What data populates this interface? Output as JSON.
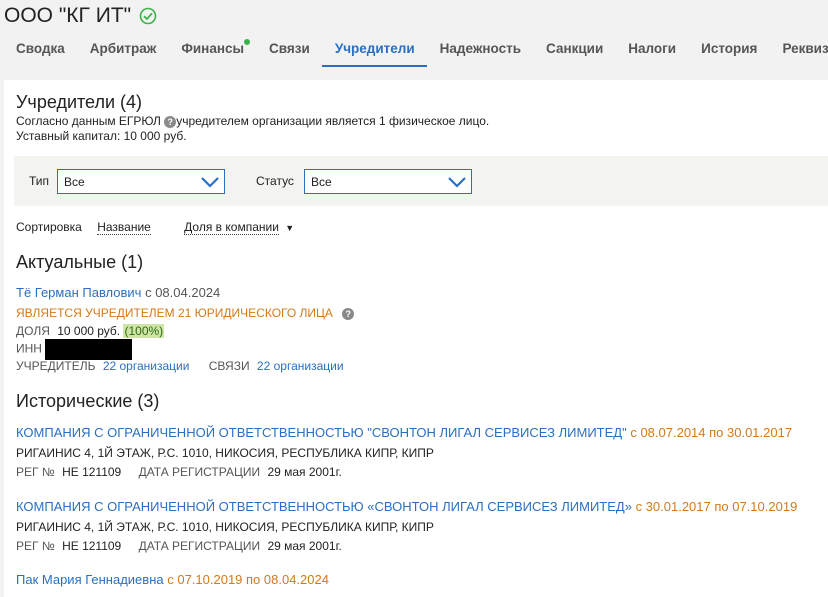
{
  "company": {
    "name": "ООО \"КГ ИТ\""
  },
  "tabs": [
    {
      "label": "Сводка"
    },
    {
      "label": "Арбитраж"
    },
    {
      "label": "Финансы"
    },
    {
      "label": "Связи"
    },
    {
      "label": "Учредители"
    },
    {
      "label": "Надежность"
    },
    {
      "label": "Санкции"
    },
    {
      "label": "Налоги"
    },
    {
      "label": "История"
    },
    {
      "label": "Реквизи"
    }
  ],
  "section": {
    "title": "Учредители (4)",
    "note_prefix": "Согласно данным ЕГРЮЛ",
    "note_suffix": "учредителем организации является 1 физическое лицо.",
    "capital": "Уставный капитал: 10 000 руб."
  },
  "filters": {
    "type_label": "Тип",
    "type_value": "Все",
    "status_label": "Статус",
    "status_value": "Все"
  },
  "sort": {
    "label": "Сортировка",
    "by_name": "Название",
    "by_share": "Доля в компании"
  },
  "current": {
    "title": "Актуальные (1)",
    "person": {
      "name": "Тё Герман Павлович",
      "since": "с 08.04.2024",
      "note": "ЯВЛЯЕТСЯ УЧРЕДИТЕЛЕМ 21 ЮРИДИЧЕСКОГО ЛИЦА",
      "share_label": "ДОЛЯ",
      "share_value": "10 000 руб.",
      "share_pct": "(100%)",
      "inn_label": "ИНН",
      "founder_label": "УЧРЕДИТЕЛЬ",
      "founder_value": "22 организации",
      "links_label": "СВЯЗИ",
      "links_value": "22 организации"
    }
  },
  "historical": {
    "title": "Исторические (3)",
    "items": [
      {
        "name": "КОМПАНИЯ С ОГРАНИЧЕННОЙ ОТВЕТСТВЕННОСТЬЮ \"СВОНТОН ЛИГАЛ СЕРВИСЕЗ ЛИМИТЕД\"",
        "period": "с 08.07.2014 по 30.01.2017",
        "address": "РИГАИНИС 4, 1Й ЭТАЖ, Р.С. 1010, НИКОСИЯ, РЕСПУБЛИКА КИПР, КИПР",
        "reg_label": "РЕГ №",
        "reg_value": "НЕ 121109",
        "date_label": "ДАТА РЕГИСТРАЦИИ",
        "date_value": "29 мая 2001г."
      },
      {
        "name": "КОМПАНИЯ С ОГРАНИЧЕННОЙ ОТВЕТСТВЕННОСТЬЮ «СВОНТОН ЛИГАЛ СЕРВИСЕЗ ЛИМИТЕД»",
        "period": "с 30.01.2017 по 07.10.2019",
        "address": "РИГАИНИС 4, 1Й ЭТАЖ, Р.С. 1010, НИКОСИЯ, РЕСПУБЛИКА КИПР, КИПР",
        "reg_label": "РЕГ №",
        "reg_value": "НЕ 121109",
        "date_label": "ДАТА РЕГИСТРАЦИИ",
        "date_value": "29 мая 2001г."
      },
      {
        "name": "Пак Мария Геннадиевна",
        "period": "с 07.10.2019 по 08.04.2024"
      }
    ]
  },
  "colors": {
    "accent": "#2a6fc1",
    "orange": "#d27a1a",
    "green": "#3cb34a"
  }
}
